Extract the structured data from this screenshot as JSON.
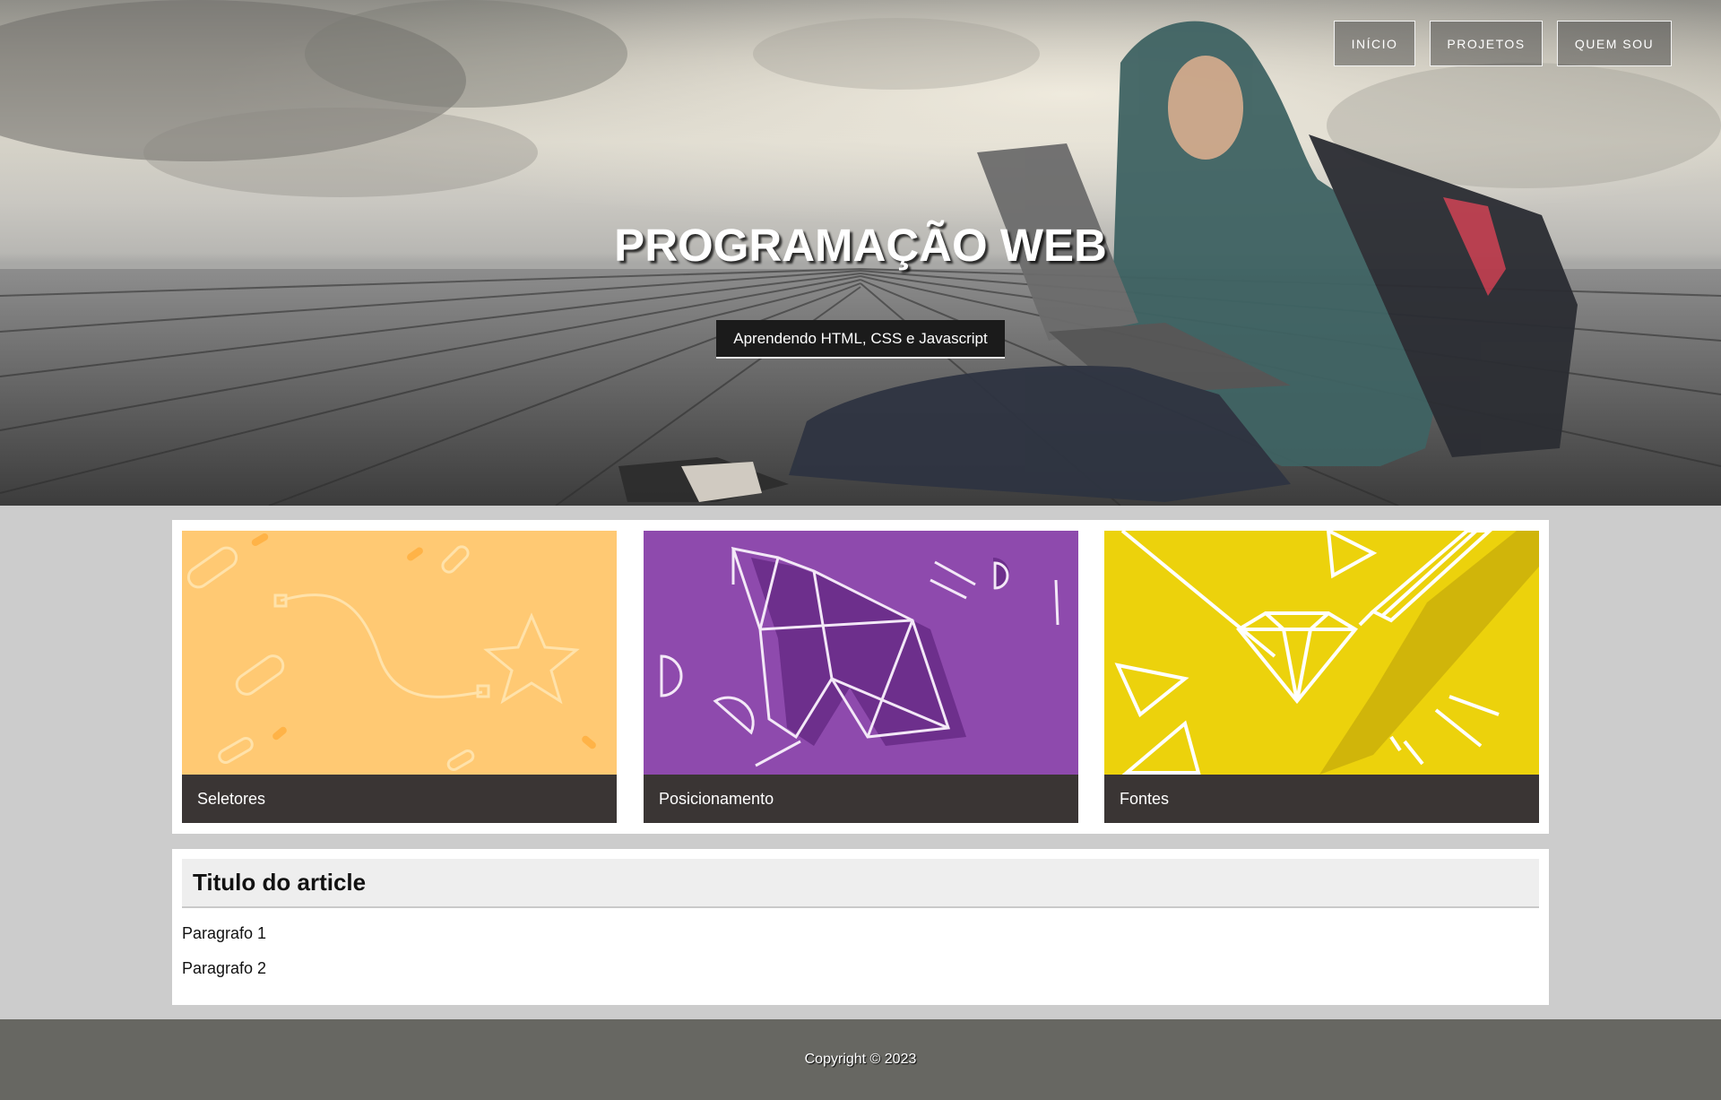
{
  "nav": {
    "items": [
      {
        "label": "INÍCIO"
      },
      {
        "label": "PROJETOS"
      },
      {
        "label": "QUEM SOU"
      }
    ]
  },
  "hero": {
    "title": "PROGRAMAÇÃO WEB",
    "subtitle": "Aprendendo HTML, CSS e Javascript"
  },
  "cards": [
    {
      "caption": "Seletores",
      "color": "#ffc973"
    },
    {
      "caption": "Posicionamento",
      "color": "#8e4aad"
    },
    {
      "caption": "Fontes",
      "color": "#ecd20c"
    }
  ],
  "article": {
    "title": "Titulo do article",
    "paragraphs": [
      "Paragrafo 1",
      "Paragrafo 2"
    ]
  },
  "footer": {
    "text": "Copyright © 2023"
  }
}
